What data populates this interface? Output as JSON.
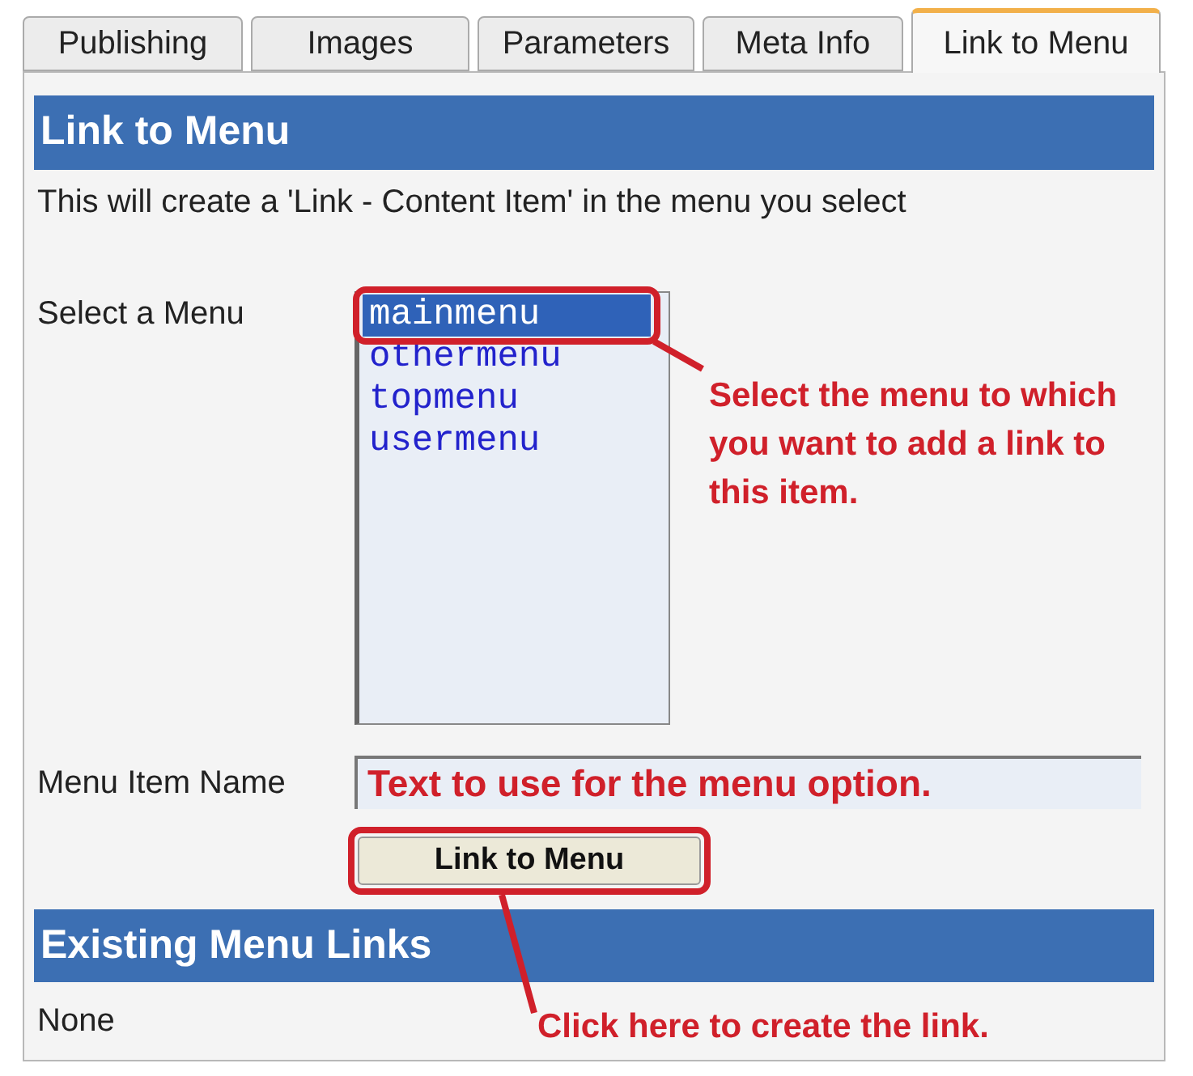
{
  "tabs": [
    {
      "label": "Publishing",
      "selected": false
    },
    {
      "label": "Images",
      "selected": false
    },
    {
      "label": "Parameters",
      "selected": false
    },
    {
      "label": "Meta Info",
      "selected": false
    },
    {
      "label": "Link to Menu",
      "selected": true
    }
  ],
  "section_header": "Link to Menu",
  "description": "This will create a 'Link - Content Item' in the menu you select",
  "menu_select": {
    "label": "Select a Menu",
    "options": [
      {
        "label": "mainmenu",
        "selected": true
      },
      {
        "label": "othermenu",
        "selected": false
      },
      {
        "label": "topmenu",
        "selected": false
      },
      {
        "label": "usermenu",
        "selected": false
      }
    ]
  },
  "menu_item_name": {
    "label": "Menu Item Name",
    "value": "Text to use for the menu option."
  },
  "link_button": "Link to Menu",
  "existing_header": "Existing Menu Links",
  "existing_links": "None",
  "annotations": [
    "Select the menu to which you want to add a link to this item.",
    "Click here to create the link."
  ]
}
